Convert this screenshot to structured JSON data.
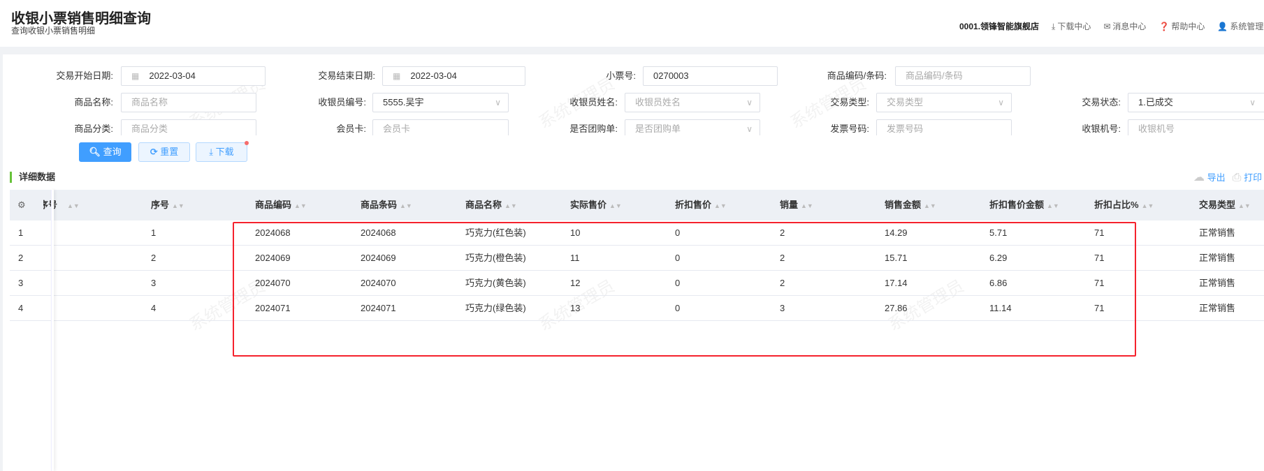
{
  "header": {
    "title": "收银小票销售明细查询",
    "subtitle": "查询收银小票销售明细",
    "store": "0001.领锋智能旗舰店",
    "download_center": "下载中心",
    "message_center": "消息中心",
    "help_center": "帮助中心",
    "user": "系统管理员"
  },
  "form": {
    "start_date": {
      "label": "交易开始日期:",
      "value": "2022-03-04"
    },
    "end_date": {
      "label": "交易结束日期:",
      "value": "2022-03-04"
    },
    "ticket_no": {
      "label": "小票号:",
      "value": "0270003"
    },
    "product_code": {
      "label": "商品编码/条码:",
      "placeholder": "商品编码/条码"
    },
    "product_name": {
      "label": "商品名称:",
      "placeholder": "商品名称"
    },
    "cashier_code": {
      "label": "收银员编号:",
      "value": "5555.吴宇"
    },
    "cashier_name": {
      "label": "收银员姓名:",
      "placeholder": "收银员姓名"
    },
    "trade_type": {
      "label": "交易类型:",
      "placeholder": "交易类型"
    },
    "trade_status": {
      "label": "交易状态:",
      "value": "1.已成交"
    },
    "category": {
      "label": "商品分类:",
      "placeholder": "商品分类"
    },
    "member_card": {
      "label": "会员卡:",
      "placeholder": "会员卡"
    },
    "group_buy": {
      "label": "是否团购单:",
      "placeholder": "是否团购单"
    },
    "invoice_no": {
      "label": "发票号码:",
      "placeholder": "发票号码"
    },
    "pos_no": {
      "label": "收银机号:",
      "placeholder": "收银机号"
    }
  },
  "buttons": {
    "query": "查询",
    "reset": "重置",
    "download": "下载"
  },
  "section": {
    "title": "详细数据",
    "export": "导出",
    "print": "打印"
  },
  "watermark": "系统管理员",
  "table": {
    "columns": [
      "明细序号",
      "序号",
      "商品编码",
      "商品条码",
      "商品名称",
      "实际售价",
      "折扣售价",
      "销量",
      "销售金额",
      "折扣售价金额",
      "折扣占比%",
      "交易类型"
    ],
    "rows": [
      {
        "idx": "1",
        "seq": "1",
        "code": "2024068",
        "barcode": "2024068",
        "name": "巧克力(红色装)",
        "price": "10",
        "disc_price": "0",
        "qty": "2",
        "amount": "14.29",
        "disc_amount": "5.71",
        "disc_pct": "71",
        "type": "正常销售"
      },
      {
        "idx": "2",
        "seq": "2",
        "code": "2024069",
        "barcode": "2024069",
        "name": "巧克力(橙色装)",
        "price": "11",
        "disc_price": "0",
        "qty": "2",
        "amount": "15.71",
        "disc_amount": "6.29",
        "disc_pct": "71",
        "type": "正常销售"
      },
      {
        "idx": "3",
        "seq": "3",
        "code": "2024070",
        "barcode": "2024070",
        "name": "巧克力(黄色装)",
        "price": "12",
        "disc_price": "0",
        "qty": "2",
        "amount": "17.14",
        "disc_amount": "6.86",
        "disc_pct": "71",
        "type": "正常销售"
      },
      {
        "idx": "4",
        "seq": "4",
        "code": "2024071",
        "barcode": "2024071",
        "name": "巧克力(绿色装)",
        "price": "13",
        "disc_price": "0",
        "qty": "3",
        "amount": "27.86",
        "disc_amount": "11.14",
        "disc_pct": "71",
        "type": "正常销售"
      }
    ]
  }
}
